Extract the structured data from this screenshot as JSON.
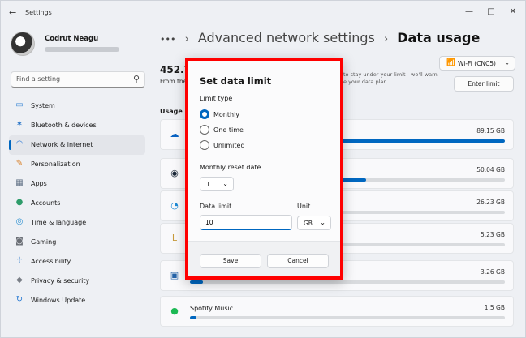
{
  "window": {
    "title": "Settings",
    "controls": [
      "minimize",
      "maximize",
      "close"
    ]
  },
  "profile": {
    "name": "Codrut Neagu"
  },
  "search": {
    "placeholder": "Find a setting"
  },
  "nav": {
    "items": [
      {
        "label": "System",
        "icon": "monitor-icon",
        "color": "#3a86d4"
      },
      {
        "label": "Bluetooth & devices",
        "icon": "bluetooth-icon",
        "color": "#1f6fc5"
      },
      {
        "label": "Network & internet",
        "icon": "wifi-icon",
        "color": "#2d7ad6",
        "active": true
      },
      {
        "label": "Personalization",
        "icon": "brush-icon",
        "color": "#d9822b"
      },
      {
        "label": "Apps",
        "icon": "apps-icon",
        "color": "#5a6b80"
      },
      {
        "label": "Accounts",
        "icon": "person-icon",
        "color": "#2e9c6a"
      },
      {
        "label": "Time & language",
        "icon": "globe-icon",
        "color": "#2a8fd0"
      },
      {
        "label": "Gaming",
        "icon": "controller-icon",
        "color": "#6b6f76"
      },
      {
        "label": "Accessibility",
        "icon": "accessibility-icon",
        "color": "#1f6fc5"
      },
      {
        "label": "Privacy & security",
        "icon": "shield-icon",
        "color": "#7a7f87"
      },
      {
        "label": "Windows Update",
        "icon": "update-icon",
        "color": "#2a7bd2"
      }
    ]
  },
  "breadcrumb": {
    "ellipsis": "•••",
    "parent": "Advanced network settings",
    "current": "Data usage"
  },
  "background": {
    "total_partial": "452.7",
    "from_partial": "From the",
    "usage_partial": "Usage s",
    "hint_line1": "to stay under your limit—we'll warn",
    "hint_line2": "e your data plan",
    "network_select": "Wi-Fi (CNC5)",
    "enter_limit": "Enter limit"
  },
  "usage": [
    {
      "name": "",
      "amount": "89.15 GB",
      "percent": 100,
      "icon": "onedrive-icon",
      "color": "#0a64c4"
    },
    {
      "name": "",
      "amount": "50.04 GB",
      "percent": 56,
      "icon": "steam-icon",
      "color": "#1b2838"
    },
    {
      "name": "",
      "amount": "26.23 GB",
      "percent": 29,
      "icon": "edge-icon",
      "color": "#1e8ad6"
    },
    {
      "name": "",
      "amount": "5.23 GB",
      "percent": 6,
      "icon": "league-icon",
      "color": "#c89b3c"
    },
    {
      "name": "",
      "amount": "3.26 GB",
      "percent": 4,
      "icon": "app-window-icon",
      "color": "#2563a8"
    },
    {
      "name": "Spotify Music",
      "amount": "1.5 GB",
      "percent": 2,
      "icon": "spotify-icon",
      "color": "#1db954"
    }
  ],
  "dialog": {
    "title": "Set data limit",
    "limit_type_label": "Limit type",
    "options": [
      {
        "label": "Monthly",
        "checked": true
      },
      {
        "label": "One time",
        "checked": false
      },
      {
        "label": "Unlimited",
        "checked": false
      }
    ],
    "reset_date_label": "Monthly reset date",
    "reset_date_value": "1",
    "data_limit_label": "Data limit",
    "data_limit_value": "10",
    "unit_label": "Unit",
    "unit_value": "GB",
    "save_label": "Save",
    "cancel_label": "Cancel",
    "highlight_color": "#ff0000"
  },
  "accent_color": "#0067c0"
}
